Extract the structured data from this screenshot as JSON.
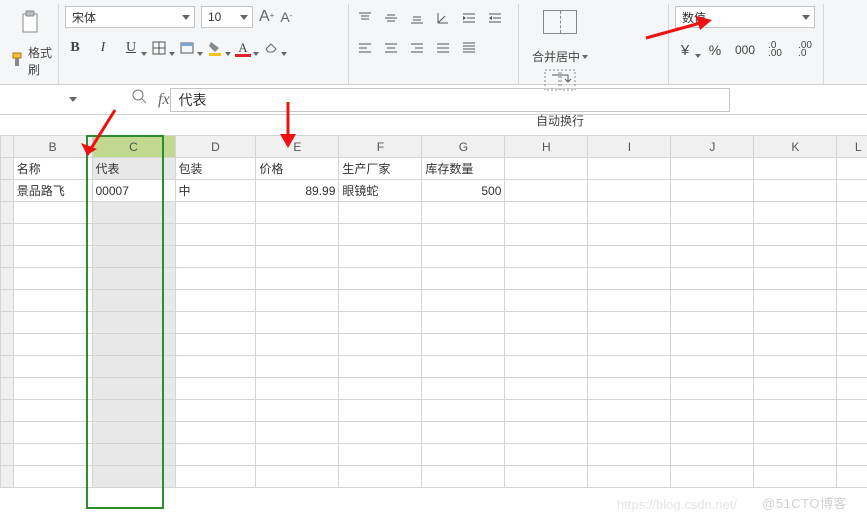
{
  "ribbon": {
    "format_painter": "格式刷",
    "font_name": "宋体",
    "font_size": "10",
    "merge_center": "合并居中",
    "wrap_text": "自动换行",
    "number_format": "数值"
  },
  "formula_bar": {
    "name_box": "",
    "fx_value": "代表"
  },
  "columns": [
    "B",
    "C",
    "D",
    "E",
    "F",
    "G",
    "H",
    "I",
    "J",
    "K",
    "L"
  ],
  "headers": {
    "B": "名称",
    "C": "代表",
    "D": "包装",
    "E": "价格",
    "F": "生产厂家",
    "G": "库存数量"
  },
  "row2": {
    "B": "景品路飞",
    "C": "00007",
    "D": "中",
    "E": "89.99",
    "F": "眼镜蛇",
    "G": "500"
  },
  "watermark": "@51CTO博客",
  "watermark2": "https://blog.csdn.net/"
}
